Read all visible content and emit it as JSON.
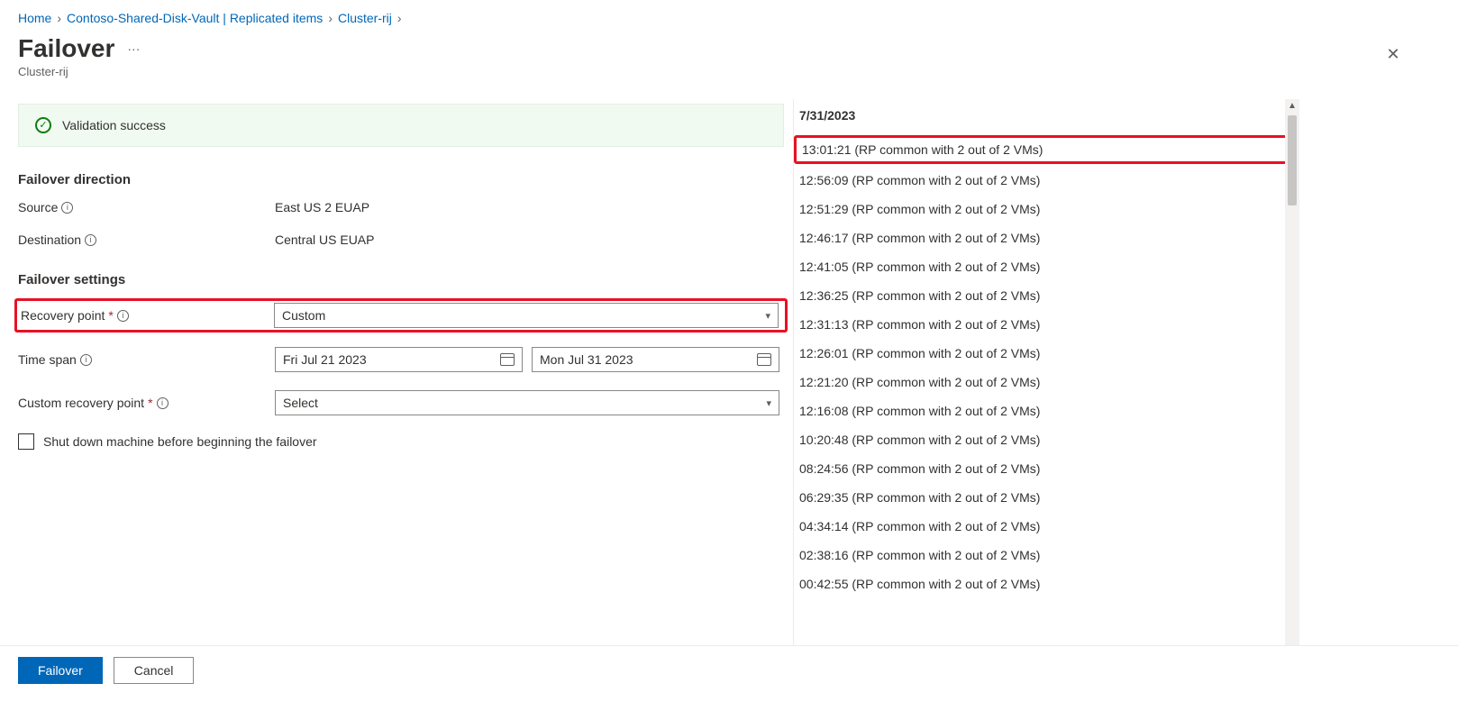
{
  "breadcrumb": {
    "home": "Home",
    "vault": "Contoso-Shared-Disk-Vault | Replicated items",
    "cluster": "Cluster-rij"
  },
  "header": {
    "title": "Failover",
    "subtitle": "Cluster-rij"
  },
  "banner": {
    "text": "Validation success"
  },
  "direction": {
    "heading": "Failover direction",
    "source_label": "Source",
    "source_value": "East US 2 EUAP",
    "dest_label": "Destination",
    "dest_value": "Central US EUAP"
  },
  "settings": {
    "heading": "Failover settings",
    "recovery_point_label": "Recovery point",
    "recovery_point_value": "Custom",
    "timespan_label": "Time span",
    "timespan_from": "Fri Jul 21 2023",
    "timespan_to": "Mon Jul 31 2023",
    "custom_rp_label": "Custom recovery point",
    "custom_rp_value": "Select",
    "shutdown_label": "Shut down machine before beginning the failover"
  },
  "footer": {
    "primary": "Failover",
    "secondary": "Cancel"
  },
  "rp_panel": {
    "date": "7/31/2023",
    "items": [
      "13:01:21 (RP common with 2 out of 2 VMs)",
      "12:56:09 (RP common with 2 out of 2 VMs)",
      "12:51:29 (RP common with 2 out of 2 VMs)",
      "12:46:17 (RP common with 2 out of 2 VMs)",
      "12:41:05 (RP common with 2 out of 2 VMs)",
      "12:36:25 (RP common with 2 out of 2 VMs)",
      "12:31:13 (RP common with 2 out of 2 VMs)",
      "12:26:01 (RP common with 2 out of 2 VMs)",
      "12:21:20 (RP common with 2 out of 2 VMs)",
      "12:16:08 (RP common with 2 out of 2 VMs)",
      "10:20:48 (RP common with 2 out of 2 VMs)",
      "08:24:56 (RP common with 2 out of 2 VMs)",
      "06:29:35 (RP common with 2 out of 2 VMs)",
      "04:34:14 (RP common with 2 out of 2 VMs)",
      "02:38:16 (RP common with 2 out of 2 VMs)",
      "00:42:55 (RP common with 2 out of 2 VMs)"
    ]
  }
}
